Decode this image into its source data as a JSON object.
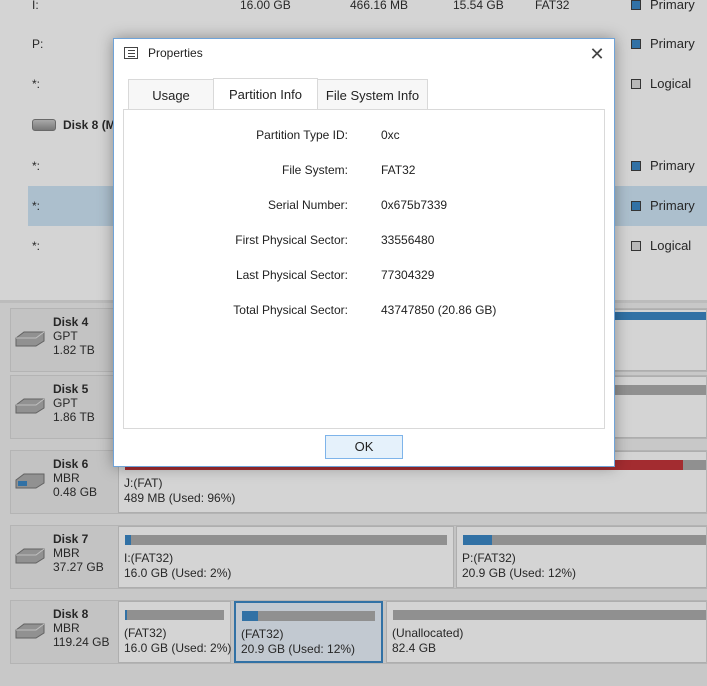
{
  "list": {
    "rows": [
      {
        "cells": [
          "I:",
          "16.00 GB",
          "466.16 MB",
          "15.54 GB",
          "FAT32"
        ],
        "type": "Primary",
        "kind": "primary"
      },
      {
        "cells": [
          "P:",
          "",
          "",
          "",
          ""
        ],
        "type": "Primary",
        "kind": "primary"
      },
      {
        "cells": [
          "*:",
          "",
          "",
          "",
          ""
        ],
        "type": "Logical",
        "kind": "logical"
      },
      {
        "cells": [
          "*:",
          "",
          "",
          "",
          ""
        ],
        "type": "Primary",
        "kind": "primary"
      },
      {
        "cells": [
          "*:",
          "",
          "",
          "",
          ""
        ],
        "type": "Primary",
        "kind": "primary"
      },
      {
        "cells": [
          "*:",
          "",
          "",
          "",
          ""
        ],
        "type": "Logical",
        "kind": "logical"
      }
    ],
    "disk8_header": "Disk 8 (M"
  },
  "disks": [
    {
      "name": "Disk 4",
      "style": "GPT",
      "size": "1.82 TB",
      "partitions": []
    },
    {
      "name": "Disk 5",
      "style": "GPT",
      "size": "1.86 TB",
      "partitions": []
    },
    {
      "name": "Disk 6",
      "style": "MBR",
      "size": "0.48 GB",
      "partitions": [
        {
          "label": "J:(FAT)",
          "detail": "489 MB (Used: 96%)",
          "used": 0.96
        }
      ]
    },
    {
      "name": "Disk 7",
      "style": "MBR",
      "size": "37.27 GB",
      "partitions": [
        {
          "label": "I:(FAT32)",
          "detail": "16.0 GB (Used: 2%)",
          "used": 0.02
        },
        {
          "label": "P:(FAT32)",
          "detail": "20.9 GB (Used: 12%)",
          "used": 0.12
        }
      ]
    },
    {
      "name": "Disk 8",
      "style": "MBR",
      "size": "119.24 GB",
      "partitions": [
        {
          "label": "(FAT32)",
          "detail": "16.0 GB (Used: 2%)",
          "used": 0.02
        },
        {
          "label": "(FAT32)",
          "detail": "20.9 GB (Used: 12%)",
          "used": 0.12
        },
        {
          "label": "(Unallocated)",
          "detail": "82.4 GB",
          "used": 0
        }
      ]
    }
  ],
  "dialog": {
    "title": "Properties",
    "tabs": [
      "Usage",
      "Partition Info",
      "File System Info"
    ],
    "active_tab": "Partition Info",
    "properties": [
      {
        "label": "Partition Type ID:",
        "value": "0xc"
      },
      {
        "label": "File System:",
        "value": "FAT32"
      },
      {
        "label": "Serial Number:",
        "value": "0x675b7339"
      },
      {
        "label": "First Physical Sector:",
        "value": "33556480"
      },
      {
        "label": "Last Physical Sector:",
        "value": "77304329"
      },
      {
        "label": "Total Physical Sector:",
        "value": "43747850 (20.86 GB)"
      }
    ],
    "ok_label": "OK"
  },
  "colors": {
    "primary": "#2f80c3",
    "used_red": "#c0282d",
    "selection": "#cce4f7"
  }
}
